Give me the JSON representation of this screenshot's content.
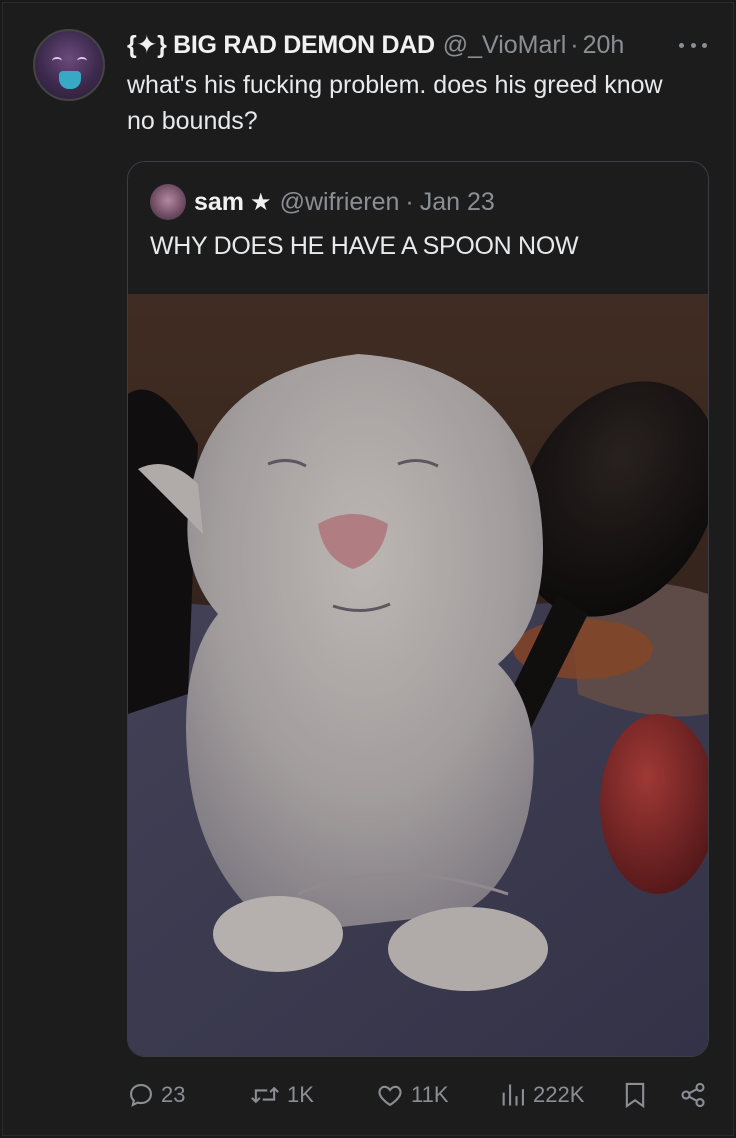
{
  "tweet": {
    "display_name": "{✦} BIG RAD DEMON DAD",
    "handle": "@_VioMarl",
    "separator": "·",
    "time": "20h",
    "text": "what's his fucking problem. does his greed know no bounds?",
    "avatar_icon": "demon-avatar"
  },
  "quote": {
    "name": "sam",
    "badge": "★",
    "handle": "@wifrieren",
    "separator": "·",
    "date": "Jan 23",
    "text": "WHY DOES HE HAVE A SPOON NOW",
    "media_icon": "cat-with-spoon-photo"
  },
  "actions": {
    "replies": "23",
    "reposts": "1K",
    "likes": "11K",
    "views": "222K"
  },
  "colors": {
    "background": "#1c1c1d",
    "text_primary": "#e7e9ea",
    "text_secondary": "#8b8f94",
    "border": "#3a3d41"
  }
}
